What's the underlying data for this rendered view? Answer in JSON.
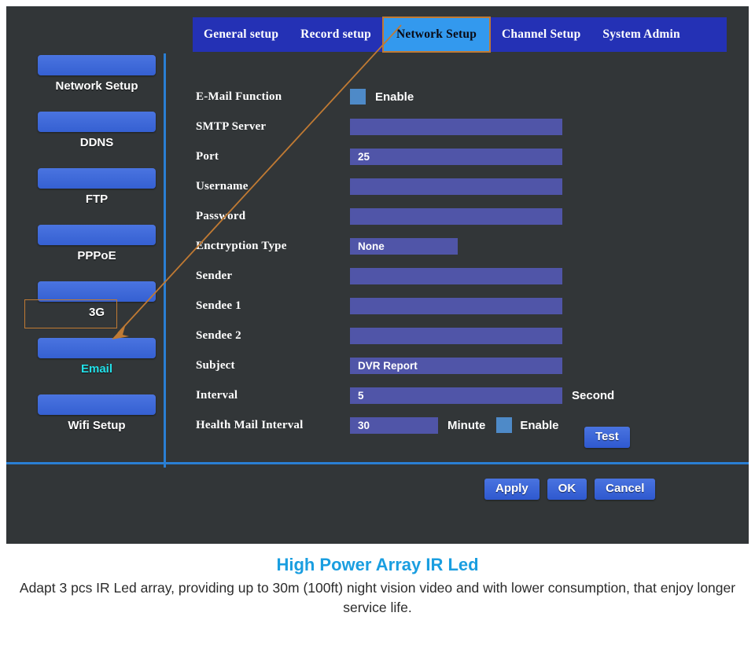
{
  "tabs": [
    {
      "label": "General setup",
      "active": false
    },
    {
      "label": "Record setup",
      "active": false
    },
    {
      "label": "Network Setup",
      "active": true
    },
    {
      "label": "Channel Setup",
      "active": false
    },
    {
      "label": "System Admin",
      "active": false
    }
  ],
  "sidebar": {
    "items": [
      {
        "label": "Network  Setup",
        "selected": false
      },
      {
        "label": "DDNS",
        "selected": false
      },
      {
        "label": "FTP",
        "selected": false
      },
      {
        "label": "PPPoE",
        "selected": false
      },
      {
        "label": "3G",
        "selected": false
      },
      {
        "label": "Email",
        "selected": true
      },
      {
        "label": "Wifi Setup",
        "selected": false
      }
    ]
  },
  "form": {
    "rows": [
      {
        "label": "E-Mail Function",
        "type": "checkbox",
        "checked": true,
        "suffix": "Enable"
      },
      {
        "label": "SMTP Server",
        "type": "text",
        "value": "",
        "size": "wide"
      },
      {
        "label": "Port",
        "type": "text",
        "value": "25",
        "size": "wide"
      },
      {
        "label": "Username",
        "type": "text",
        "value": "",
        "size": "wide"
      },
      {
        "label": "Password",
        "type": "text",
        "value": "",
        "size": "wide"
      },
      {
        "label": "Enctryption Type",
        "type": "select",
        "value": "None",
        "size": "drop"
      },
      {
        "label": "Sender",
        "type": "text",
        "value": "",
        "size": "wide"
      },
      {
        "label": "Sendee 1",
        "type": "text",
        "value": "",
        "size": "wide"
      },
      {
        "label": "Sendee 2",
        "type": "text",
        "value": "",
        "size": "wide"
      },
      {
        "label": "Subject",
        "type": "text",
        "value": "DVR Report",
        "size": "wide"
      },
      {
        "label": "Interval",
        "type": "text",
        "value": "5",
        "size": "wide",
        "suffix": "Second"
      },
      {
        "label": "Health Mail Interval",
        "type": "text",
        "value": "30",
        "size": "small",
        "suffix": "Minute",
        "checkbox2": true,
        "suffix2": "Enable"
      }
    ]
  },
  "buttons": {
    "test": "Test",
    "apply": "Apply",
    "ok": "OK",
    "cancel": "Cancel"
  },
  "caption": {
    "title": "High Power Array IR Led",
    "body": "Adapt 3 pcs IR Led array, providing up to 30m (100ft) night vision video and with lower consumption, that enjoy longer service life."
  },
  "colors": {
    "panel_bg": "#323638",
    "tabbar_bg": "#2431b5",
    "tab_active_bg": "#3399ee",
    "highlight_border": "#c07a33",
    "selected_label": "#22e0e8",
    "input_bg": "#5055a8",
    "checkbox": "#4e8ac8",
    "divider": "#2a7fd4",
    "button": "#3560d2",
    "caption_title": "#1a9ee0"
  }
}
